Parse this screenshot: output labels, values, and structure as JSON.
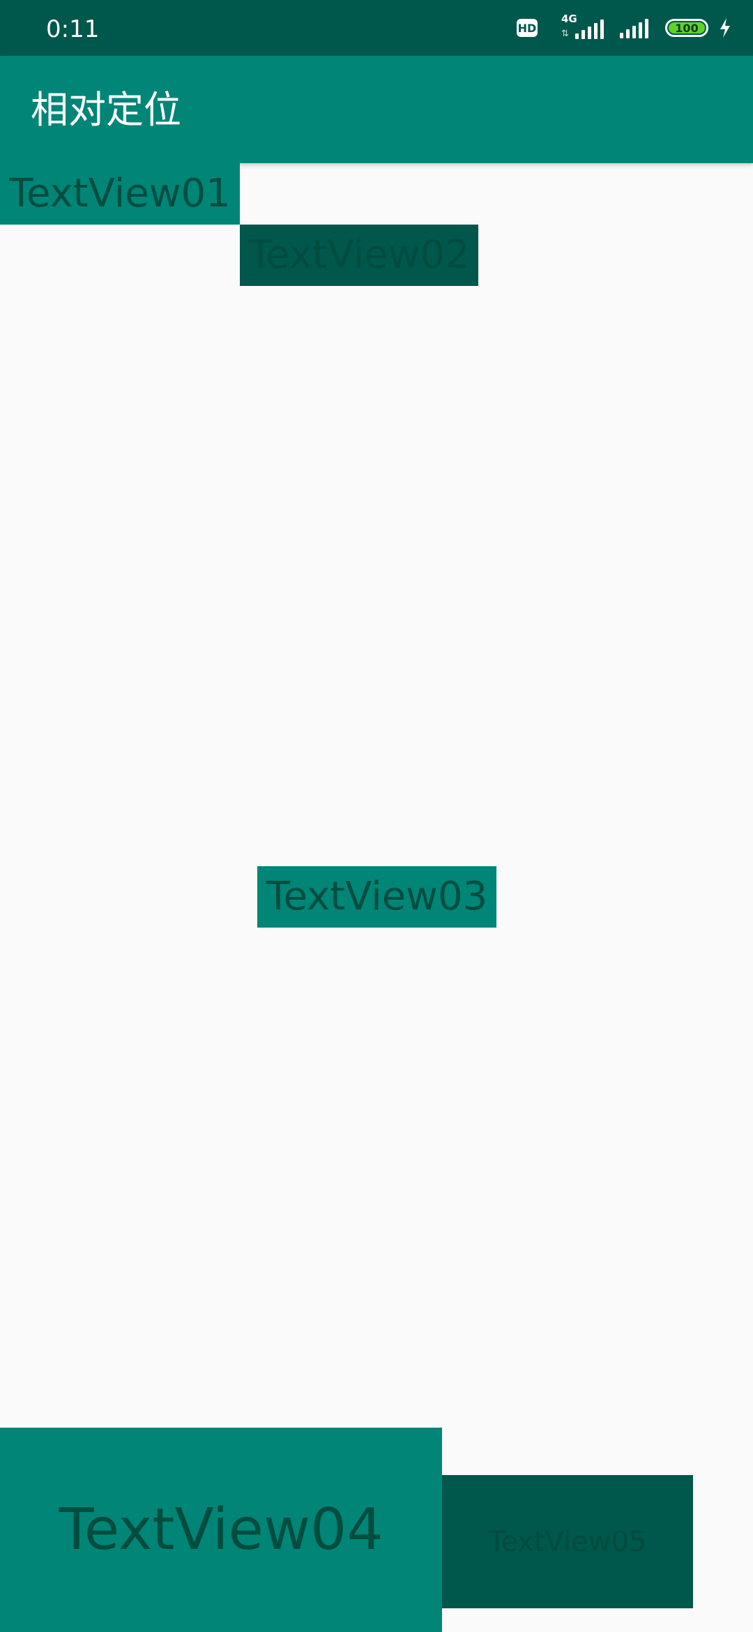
{
  "status_bar": {
    "time": "0:11",
    "hd_label": "HD",
    "network_label": "4G",
    "battery_level": "100"
  },
  "app_bar": {
    "title": "相对定位"
  },
  "text_views": {
    "tv1": "TextView01",
    "tv2": "TextView02",
    "tv3": "TextView03",
    "tv4": "TextView04",
    "tv5": "TextView05"
  },
  "colors": {
    "primary": "#008577",
    "primary_dark": "#00574b",
    "text": "#004d40",
    "background": "#fafafa"
  }
}
